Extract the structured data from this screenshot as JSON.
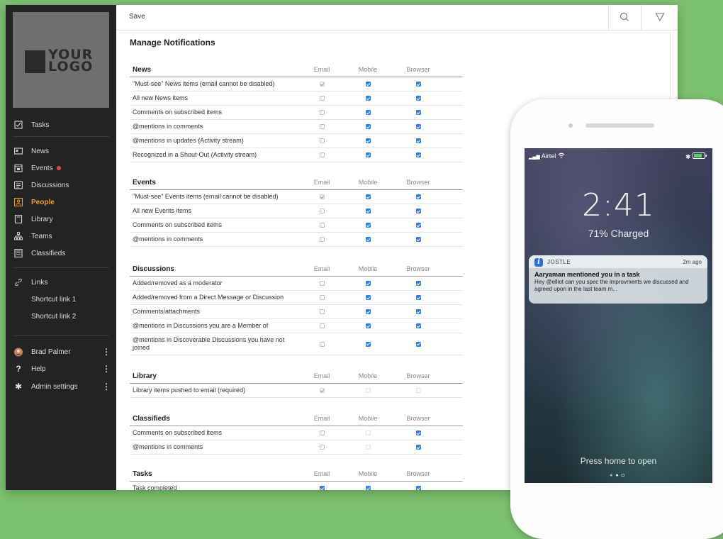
{
  "sidebar": {
    "logo_line1": "YOUR",
    "logo_line2": "LOGO",
    "tasks": "Tasks",
    "items": [
      "News",
      "Events",
      "Discussions",
      "People",
      "Library",
      "Teams",
      "Classifieds"
    ],
    "active_item": "People",
    "links_label": "Links",
    "links": [
      "Shortcut link 1",
      "Shortcut link 2"
    ],
    "user_name": "Brad Palmer",
    "help": "Help",
    "admin": "Admin settings"
  },
  "toolbar": {
    "save_label": "Save",
    "search_icon": "search-icon",
    "filter_icon": "filter-icon"
  },
  "page": {
    "title": "Manage Notifications"
  },
  "columns": [
    "Email",
    "Mobile",
    "Browser"
  ],
  "sections": {
    "news": {
      "title": "News",
      "rows": [
        {
          "label": "\"Must-see\" News items (email cannot be disabled)",
          "email": "disabled-checked",
          "mobile": "on",
          "browser": "on"
        },
        {
          "label": "All new News items",
          "email": "off",
          "mobile": "on",
          "browser": "on"
        },
        {
          "label": "Comments on subscribed items",
          "email": "off",
          "mobile": "on",
          "browser": "on"
        },
        {
          "label": "@mentions in comments",
          "email": "off",
          "mobile": "on",
          "browser": "on"
        },
        {
          "label": "@mentions in updates (Activity stream)",
          "email": "off",
          "mobile": "on",
          "browser": "on"
        },
        {
          "label": "Recognized in a Shout-Out (Activity stream)",
          "email": "off",
          "mobile": "on",
          "browser": "on"
        }
      ]
    },
    "events": {
      "title": "Events",
      "rows": [
        {
          "label": "\"Must-see\" Events items (email cannot be disabled)",
          "email": "disabled-checked",
          "mobile": "on",
          "browser": "on"
        },
        {
          "label": "All new Events items",
          "email": "off",
          "mobile": "on",
          "browser": "on"
        },
        {
          "label": "Comments on subscribed items",
          "email": "off",
          "mobile": "on",
          "browser": "on"
        },
        {
          "label": "@mentions in comments",
          "email": "off",
          "mobile": "on",
          "browser": "on"
        }
      ]
    },
    "discussions": {
      "title": "Discussions",
      "rows": [
        {
          "label": "Added/removed as a moderator",
          "email": "off",
          "mobile": "on",
          "browser": "on"
        },
        {
          "label": "Added/removed from a Direct Message or Discussion",
          "email": "off",
          "mobile": "on",
          "browser": "on"
        },
        {
          "label": "Comments/attachments",
          "email": "off",
          "mobile": "on",
          "browser": "on"
        },
        {
          "label": "@mentions in Discussions you are a Member of",
          "email": "off",
          "mobile": "on",
          "browser": "on"
        },
        {
          "label": "@mentions in Discoverable Discussions you have not joined",
          "email": "off",
          "mobile": "on",
          "browser": "on"
        }
      ]
    },
    "library": {
      "title": "Library",
      "rows": [
        {
          "label": "Library items pushed to email (required)",
          "email": "disabled-checked",
          "mobile": "disabled",
          "browser": "disabled"
        }
      ]
    },
    "classifieds": {
      "title": "Classifieds",
      "rows": [
        {
          "label": "Comments on subscribed items",
          "email": "off",
          "mobile": "disabled",
          "browser": "on"
        },
        {
          "label": "@mentions in comments",
          "email": "off",
          "mobile": "disabled",
          "browser": "on"
        }
      ]
    },
    "tasks": {
      "title": "Tasks",
      "rows": [
        {
          "label": "Task completed",
          "email": "on",
          "mobile": "on",
          "browser": "on"
        }
      ]
    }
  },
  "phone": {
    "carrier": "Airtel",
    "time": "2:41",
    "charged": "71% Charged",
    "notification": {
      "app": "JOSTLE",
      "age": "2m ago",
      "title": "Aaryaman mentioned you in a task",
      "body": "Hey @elliot can you spec the improvments we discussed and agreed upon in the last team m..."
    },
    "press_home": "Press home to open"
  },
  "colors": {
    "accent": "#2f7ee0",
    "active_nav": "#f0a030",
    "sidebar_bg": "#232323",
    "background": "#7cc16f"
  }
}
